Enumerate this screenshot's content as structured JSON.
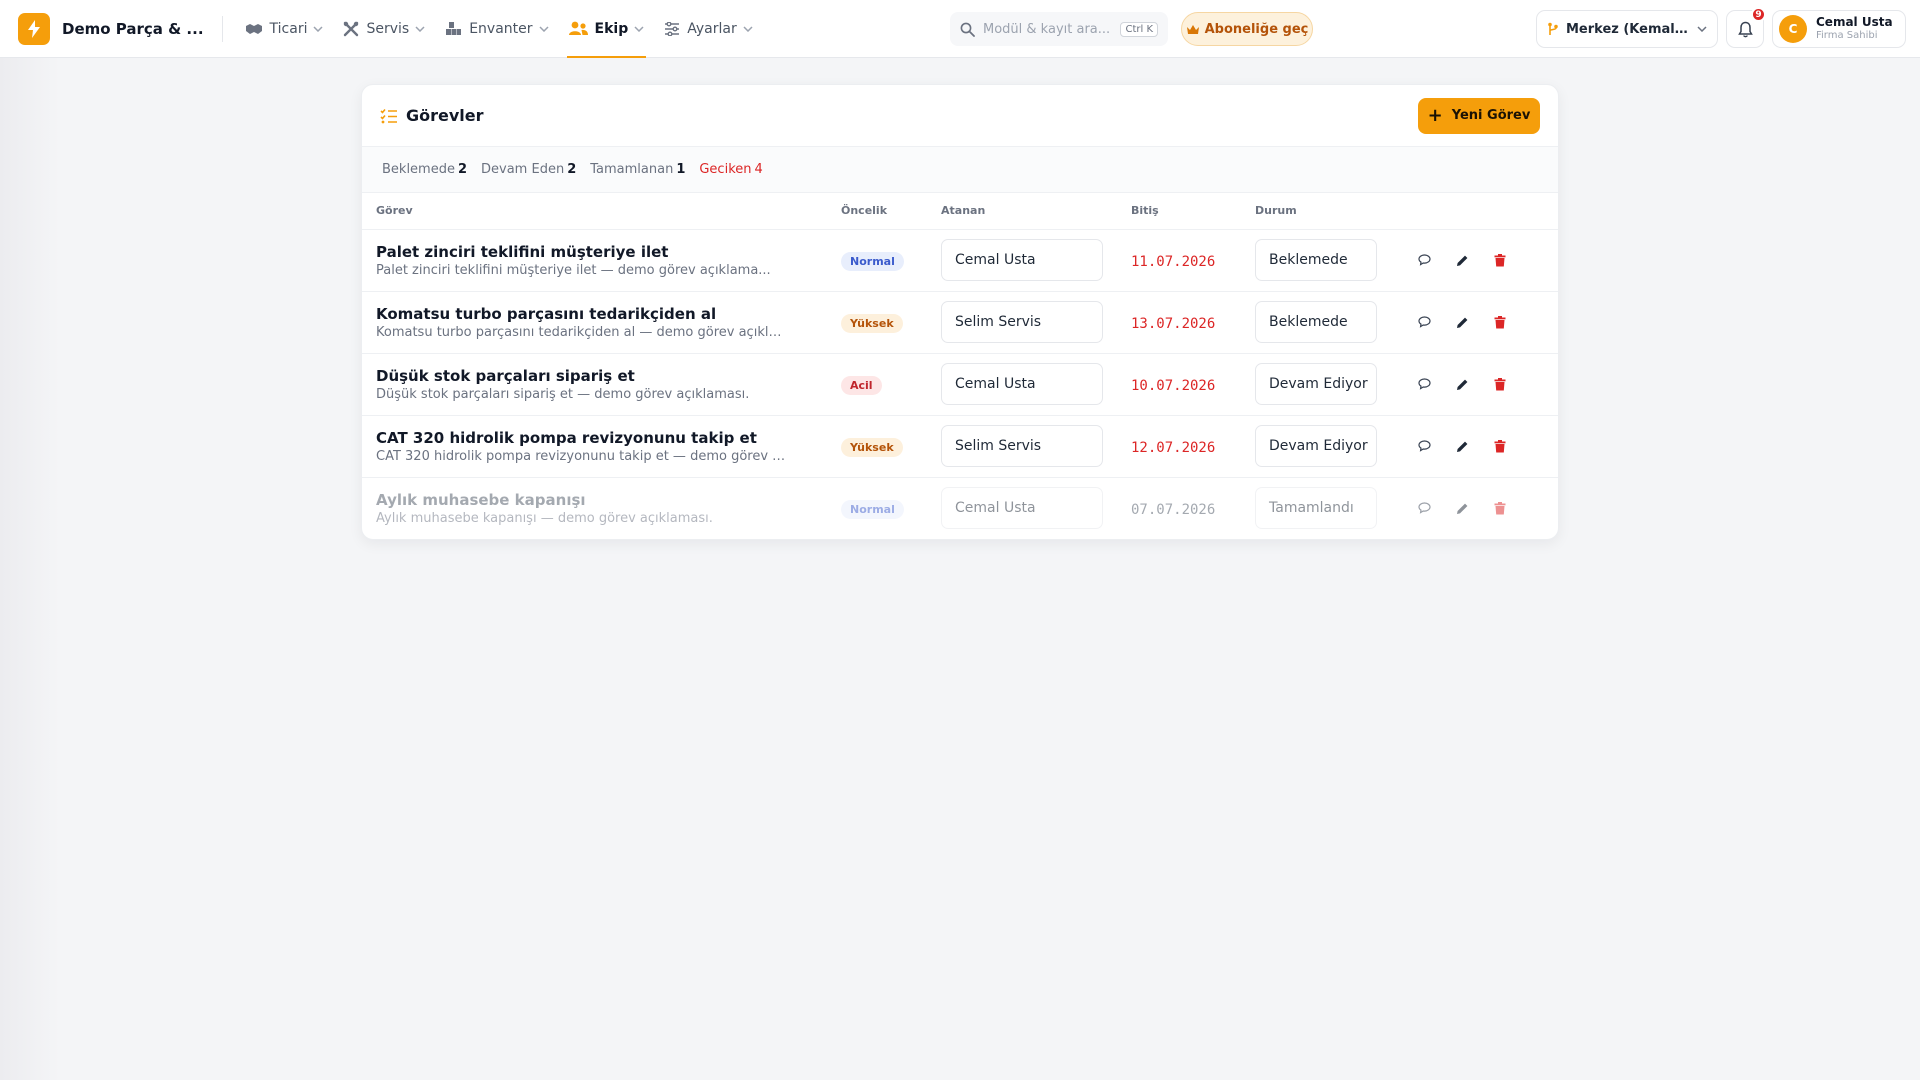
{
  "header": {
    "brand_name": "Demo Parça & ...",
    "nav": [
      {
        "label": "Ticari",
        "icon": "handshake-icon"
      },
      {
        "label": "Servis",
        "icon": "tools-icon"
      },
      {
        "label": "Envanter",
        "icon": "warehouse-icon"
      },
      {
        "label": "Ekip",
        "icon": "team-icon",
        "active": true
      },
      {
        "label": "Ayarlar",
        "icon": "sliders-icon"
      }
    ],
    "search_placeholder": "Modül & kayıt ara...",
    "search_shortcut": "Ctrl K",
    "subscribe_label": "Aboneliğe geç",
    "branch_label": "Merkez (Kemalpa...",
    "notification_count": "9",
    "user": {
      "initial": "C",
      "name": "Cemal Usta",
      "role": "Firma Sahibi"
    }
  },
  "tasks_card": {
    "title": "Görevler",
    "new_button_label": "Yeni Görev",
    "stats": [
      {
        "label": "Beklemede",
        "count": "2"
      },
      {
        "label": "Devam Eden",
        "count": "2"
      },
      {
        "label": "Tamamlanan",
        "count": "1"
      },
      {
        "label": "Geciken",
        "count": "4",
        "highlight": true
      }
    ],
    "columns": {
      "task": "Görev",
      "priority": "Öncelik",
      "assignee": "Atanan",
      "due": "Bitiş",
      "status": "Durum"
    },
    "rows": [
      {
        "title": "Palet zinciri teklifini müşteriye ilet",
        "description": "Palet zinciri teklifini müşteriye ilet — demo görev açıklama...",
        "priority": "Normal",
        "assignee": "Cemal Usta",
        "due": "11.07.2026",
        "overdue": true,
        "status": "Beklemede",
        "done": false
      },
      {
        "title": "Komatsu turbo parçasını tedarikçiden al",
        "description": "Komatsu turbo parçasını tedarikçiden al — demo görev açıklam...",
        "priority": "Yüksek",
        "assignee": "Selim Servis",
        "due": "13.07.2026",
        "overdue": true,
        "status": "Beklemede",
        "done": false
      },
      {
        "title": "Düşük stok parçaları sipariş et",
        "description": "Düşük stok parçaları sipariş et — demo görev açıklaması.",
        "priority": "Acil",
        "assignee": "Cemal Usta",
        "due": "10.07.2026",
        "overdue": true,
        "status": "Devam Ediyor",
        "done": false
      },
      {
        "title": "CAT 320 hidrolik pompa revizyonunu takip et",
        "description": "CAT 320 hidrolik pompa revizyonunu takip et — demo görev açı...",
        "priority": "Yüksek",
        "assignee": "Selim Servis",
        "due": "12.07.2026",
        "overdue": true,
        "status": "Devam Ediyor",
        "done": false
      },
      {
        "title": "Aylık muhasebe kapanışı",
        "description": "Aylık muhasebe kapanışı — demo görev açıklaması.",
        "priority": "Normal",
        "assignee": "Cemal Usta",
        "due": "07.07.2026",
        "overdue": false,
        "status": "Tamamlandı",
        "done": true
      }
    ]
  },
  "colors": {
    "accent": "#f59e0b",
    "overdue": "#dc2626",
    "priority_normal_bg": "#e8eefc",
    "priority_normal_fg": "#3b5bcc",
    "priority_high_bg": "#fdf0dc",
    "priority_high_fg": "#b45309",
    "priority_urgent_bg": "#fde6e6",
    "priority_urgent_fg": "#c0262d",
    "delete": "#dc2626"
  }
}
